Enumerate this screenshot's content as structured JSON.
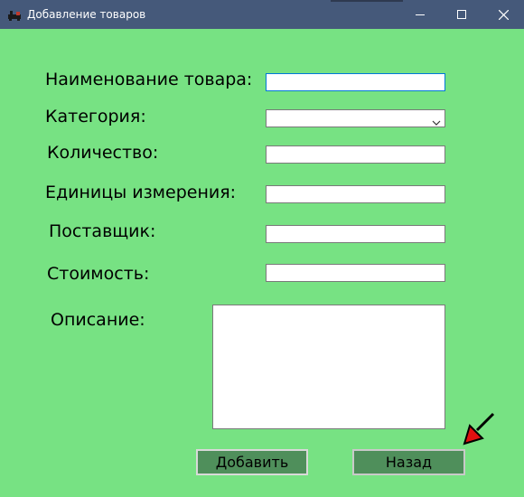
{
  "window": {
    "title": "Добавление товаров",
    "background": "#77e283",
    "titlebar_color": "#45597a"
  },
  "form": {
    "name_label": "Наименование товара:",
    "category_label": "Категория:",
    "quantity_label": "Количество:",
    "units_label": "Единицы измерения:",
    "supplier_label": "Поставщик:",
    "cost_label": "Стоимость:",
    "description_label": "Описание:",
    "name_value": "",
    "category_value": "",
    "quantity_value": "",
    "units_value": "",
    "supplier_value": "",
    "cost_value": "",
    "description_value": ""
  },
  "buttons": {
    "add_label": "Добавить",
    "back_label": "Назад",
    "button_color": "#4f8f5b"
  },
  "icons": {
    "app": "app-icon",
    "minimize": "minimize-icon",
    "maximize": "maximize-icon",
    "close": "close-icon",
    "dropdown": "chevron-down-icon",
    "pointer": "red-arrow-pointer"
  }
}
